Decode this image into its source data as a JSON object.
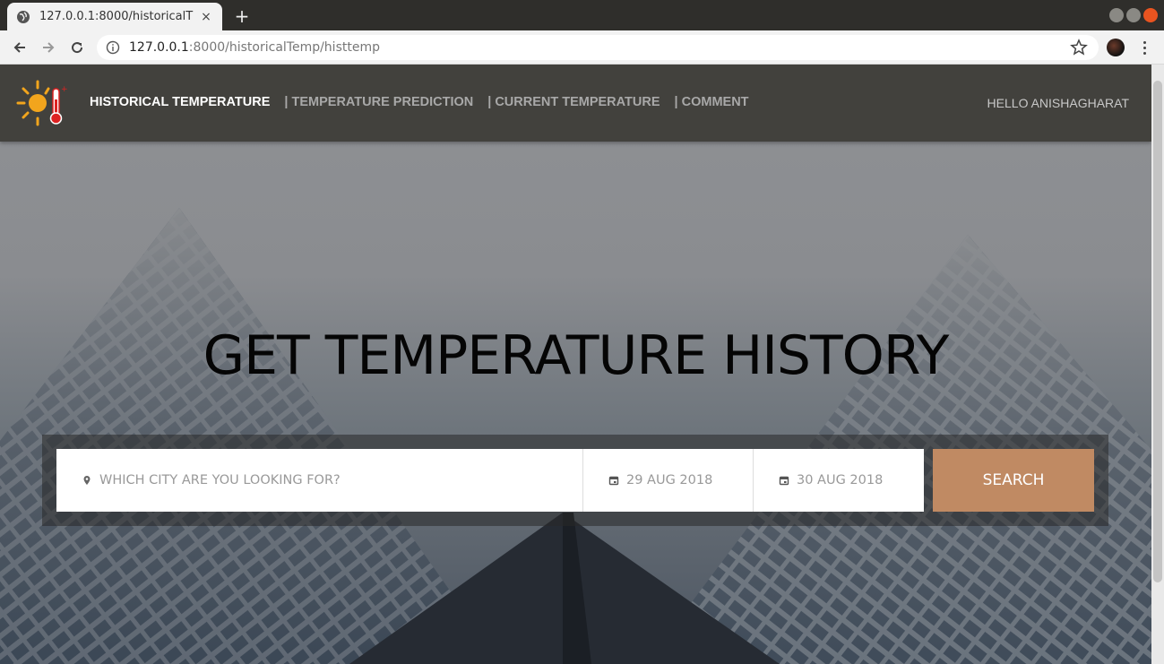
{
  "browser": {
    "tab_title": "127.0.0.1:8000/historicalT",
    "url_host": "127.0.0.1",
    "url_path": ":8000/historicalTemp/histtemp",
    "new_tab_label": "+",
    "tab_close_label": "×"
  },
  "navbar": {
    "links": [
      {
        "label": "HISTORICAL TEMPERATURE",
        "active": true
      },
      {
        "label": "| TEMPERATURE PREDICTION",
        "active": false
      },
      {
        "label": "| CURRENT TEMPERATURE",
        "active": false
      },
      {
        "label": "| COMMENT",
        "active": false
      }
    ],
    "greeting": "HELLO ANISHAGHARAT"
  },
  "hero": {
    "title": "GET TEMPERATURE HISTORY"
  },
  "search": {
    "city_placeholder": "WHICH CITY ARE YOU LOOKING FOR?",
    "date_from": "29 AUG 2018",
    "date_to": "30 AUG 2018",
    "button_label": "SEARCH"
  },
  "colors": {
    "navbar_bg": "#42413d",
    "search_button": "#c08a63",
    "active_link": "#ffffff",
    "inactive_link": "#a8a8a8"
  },
  "icons": {
    "logo": "sun-thermometer-icon",
    "city": "map-pin-icon",
    "date": "calendar-icon"
  }
}
